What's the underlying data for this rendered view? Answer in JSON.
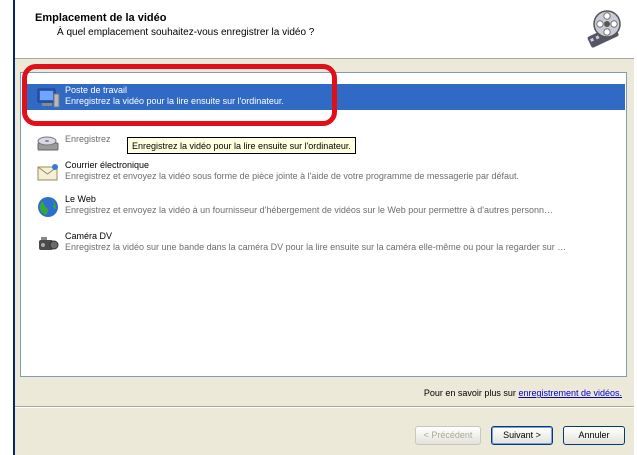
{
  "header": {
    "title": "Emplacement de la vidéo",
    "subtitle": "À quel emplacement souhaitez-vous enregistrer la vidéo ?",
    "icon": "film-reel-icon"
  },
  "options": [
    {
      "title": "Poste de travail",
      "desc": "Enregistrez la vidéo pour la lire ensuite sur l'ordinateur.",
      "icon": "computer-icon",
      "selected": true
    },
    {
      "title": "",
      "desc": "Enregistrez",
      "icon": "cd-drive-icon",
      "selected": false
    },
    {
      "title": "Courrier électronique",
      "desc": "Enregistrez et envoyez la vidéo sous forme de pièce jointe à l'aide de votre programme de messagerie par défaut.",
      "icon": "email-icon",
      "selected": false
    },
    {
      "title": "Le Web",
      "desc": "Enregistrez et envoyez la vidéo à un fournisseur d'hébergement de vidéos sur le Web pour permettre à d'autres personn…",
      "icon": "globe-icon",
      "selected": false
    },
    {
      "title": "Caméra DV",
      "desc": "Enregistrez la vidéo sur une bande dans la caméra DV pour la lire ensuite sur la caméra elle-même ou pour la regarder sur …",
      "icon": "camcorder-icon",
      "selected": false
    }
  ],
  "tooltip": "Enregistrez la vidéo pour la lire ensuite sur l'ordinateur.",
  "learn_more": {
    "prefix": "Pour en savoir plus sur ",
    "link": "enregistrement de vidéos."
  },
  "buttons": {
    "back": "< Précédent",
    "next": "Suivant >",
    "cancel": "Annuler"
  },
  "colors": {
    "selection": "#316ac5",
    "annotation_ring": "#e0101a",
    "tooltip_bg": "#ffffe1"
  }
}
